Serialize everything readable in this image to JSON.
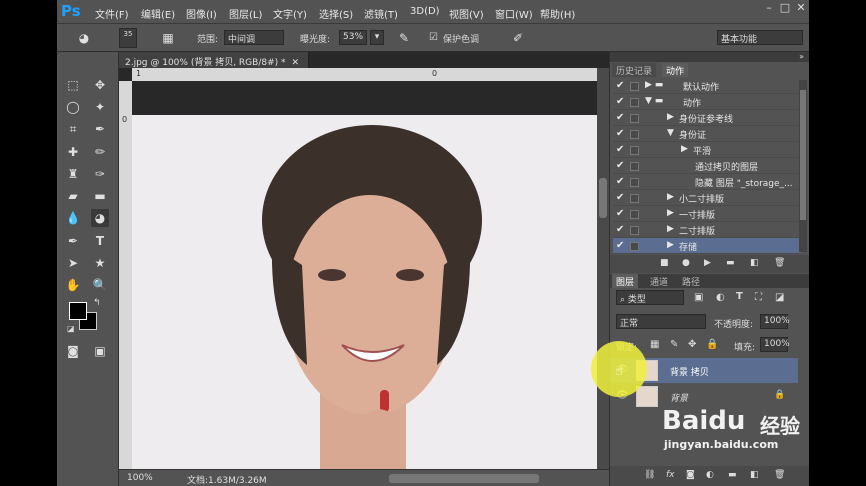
{
  "app": {
    "logo": "Ps"
  },
  "menu": [
    "文件(F)",
    "编辑(E)",
    "图像(I)",
    "图层(L)",
    "文字(Y)",
    "选择(S)",
    "滤镜(T)",
    "3D(D)",
    "视图(V)",
    "窗口(W)",
    "帮助(H)"
  ],
  "options": {
    "brush_size": "35",
    "range_label": "范围:",
    "range_value": "中间调",
    "exposure_label": "曝光度:",
    "exposure_value": "53%",
    "protect_tones": "保护色调",
    "workspace": "基本功能"
  },
  "document": {
    "tab_title": "2.jpg @ 100% (背景 拷贝, RGB/8#) *",
    "zoom": "100%",
    "doc_info": "文档:1.63M/3.26M",
    "ruler_top": [
      "1",
      "0"
    ],
    "ruler_left": "0"
  },
  "history_panel": {
    "tabs": [
      "历史记录",
      "动作"
    ],
    "rows": [
      "默认动作",
      "动作",
      "身份证参考线",
      "身份证",
      "平滑",
      "通过拷贝的图层",
      "隐藏 图层 \"_storage_...",
      "小二寸排版",
      "一寸排版",
      "二寸排版",
      "存储"
    ]
  },
  "layers_panel": {
    "tabs": [
      "图层",
      "通道",
      "路径"
    ],
    "filter": "类型",
    "blend_mode": "正常",
    "opacity_label": "不透明度:",
    "opacity": "100%",
    "lock_label": "锁定:",
    "fill_label": "填充:",
    "fill": "100%",
    "layers": [
      {
        "name": "背景 拷贝",
        "selected": true
      },
      {
        "name": "背景",
        "selected": false
      }
    ]
  },
  "watermark": {
    "brand": "Baidu",
    "brand_cn": "经验",
    "url": "jingyan.baidu.com"
  }
}
